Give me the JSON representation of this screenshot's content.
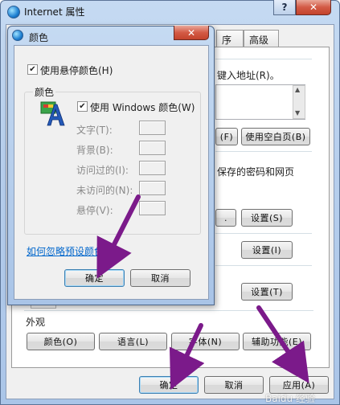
{
  "outer": {
    "title": "Internet 属性",
    "caption_help": "?",
    "caption_close": "✕",
    "tabs": [
      "序",
      "高级"
    ],
    "address_text": "键入地址(R)。",
    "btn_use_default": "(F)",
    "btn_use_blank": "使用空白页(B)",
    "history_text": "保存的密码和网页",
    "btn_dot": ".",
    "btn_settings_s": "设置(S)",
    "btn_settings_i": "设置(I)",
    "btn_settings_t": "设置(T)",
    "appearance_label": "外观",
    "btn_colors": "颜色(O)",
    "btn_languages": "语言(L)",
    "btn_fonts": "字体(N)",
    "btn_accessibility": "辅助功能(E)",
    "btn_ok": "确定",
    "btn_cancel": "取消",
    "btn_apply": "应用(A)"
  },
  "dialog": {
    "title": "颜色",
    "close": "✕",
    "use_hover_color": "使用悬停颜色(H)",
    "group_label": "颜色",
    "use_windows_colors": "使用 Windows 颜色(W)",
    "rows": [
      {
        "label": "文字(T):"
      },
      {
        "label": "背景(B):"
      },
      {
        "label": "访问过的(I):"
      },
      {
        "label": "未访问的(N):"
      },
      {
        "label": "悬停(V):"
      }
    ],
    "link": "如何忽略预设颜色",
    "btn_ok": "确定",
    "btn_cancel": "取消"
  },
  "watermark": "Baidu 经验",
  "colors": {
    "arrow": "#7b1a8a"
  }
}
